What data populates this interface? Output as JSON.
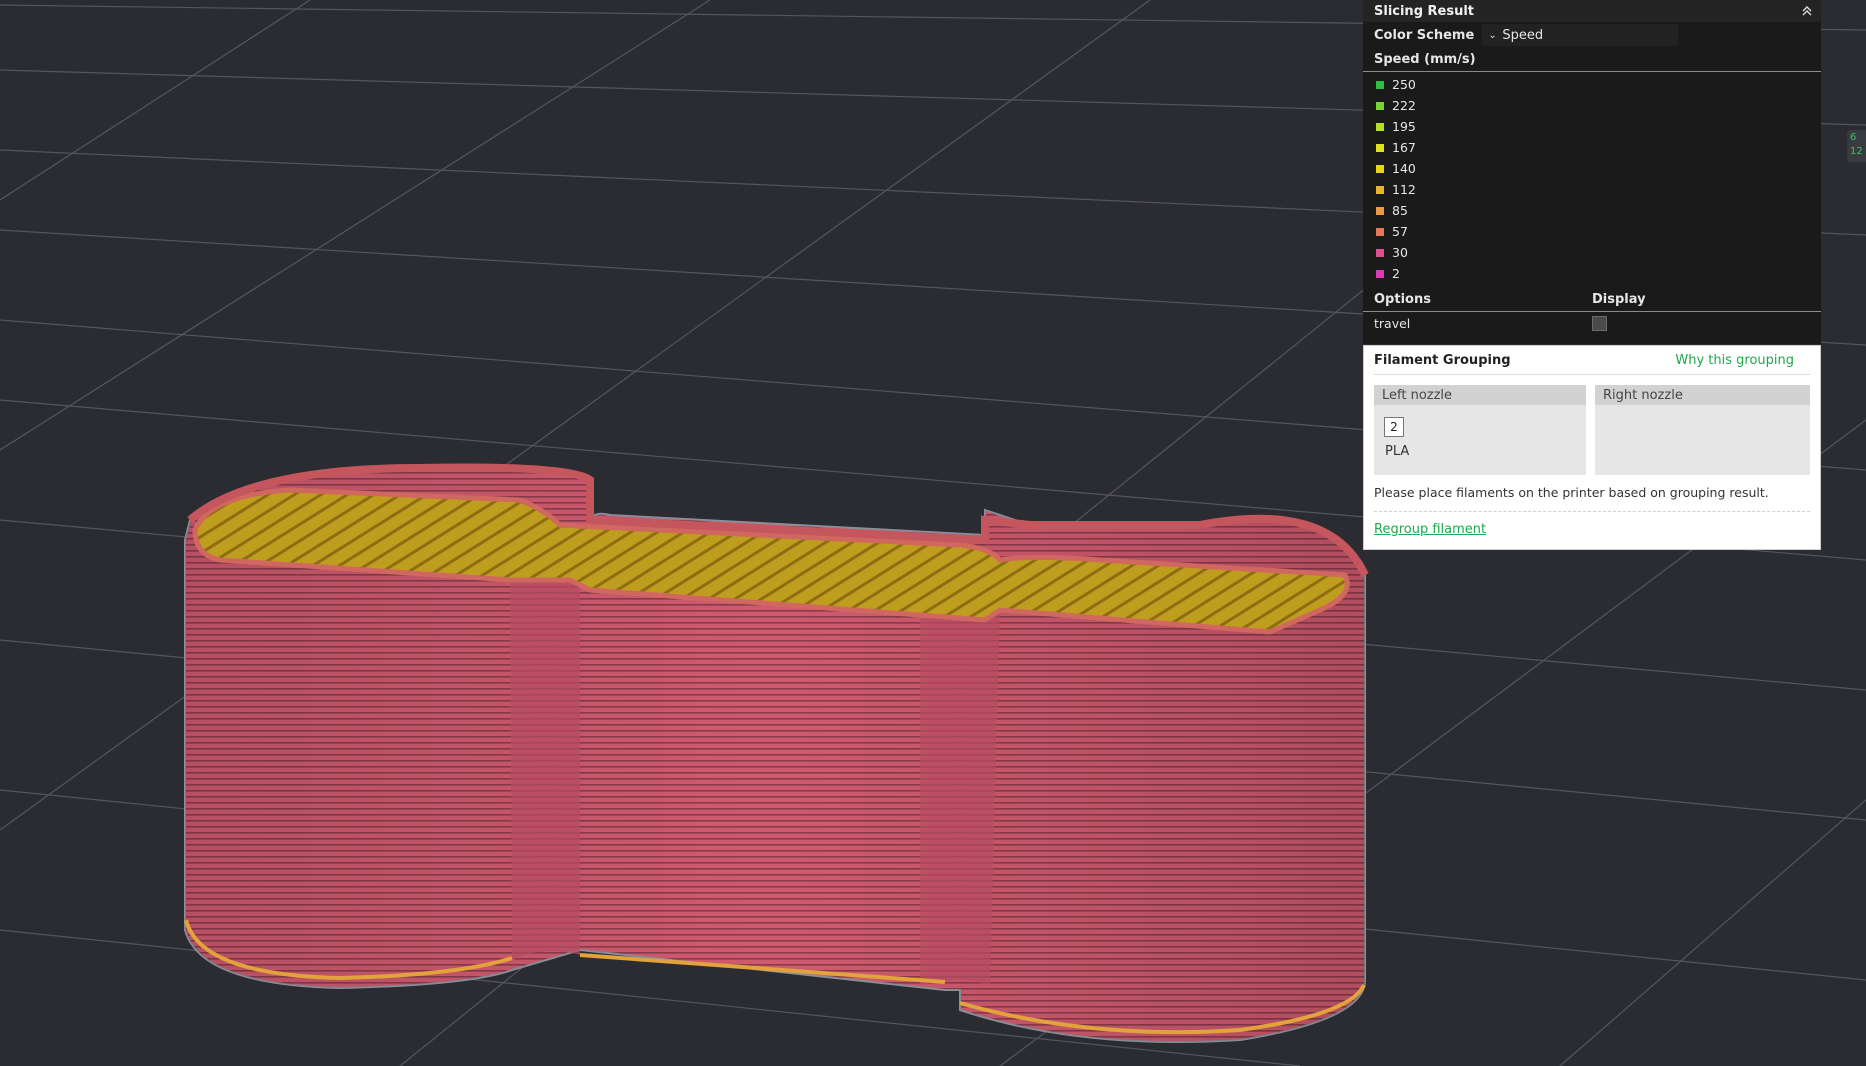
{
  "slicing_panel": {
    "title": "Slicing Result",
    "color_scheme_label": "Color Scheme",
    "color_scheme_value": "Speed",
    "legend_title": "Speed (mm/s)",
    "legend": [
      {
        "label": "250",
        "color": "#2fbf3e"
      },
      {
        "label": "222",
        "color": "#7cd431"
      },
      {
        "label": "195",
        "color": "#b7e021"
      },
      {
        "label": "167",
        "color": "#dfe21c"
      },
      {
        "label": "140",
        "color": "#e9d41c"
      },
      {
        "label": "112",
        "color": "#e7b52d"
      },
      {
        "label": "85",
        "color": "#e99a45"
      },
      {
        "label": "57",
        "color": "#e6795a"
      },
      {
        "label": "30",
        "color": "#e04e8f"
      },
      {
        "label": "2",
        "color": "#d93bb7"
      }
    ],
    "options_header": "Options",
    "display_header": "Display",
    "options": [
      {
        "label": "travel",
        "checked": false
      }
    ]
  },
  "filament_grouping": {
    "title": "Filament Grouping",
    "why_link": "Why this grouping",
    "left_nozzle": {
      "label": "Left nozzle",
      "filaments": [
        {
          "number": "2",
          "type": "PLA"
        }
      ]
    },
    "right_nozzle": {
      "label": "Right nozzle"
    },
    "note": "Please place filaments on the printer based on grouping result.",
    "regroup_link": "Regroup filament"
  },
  "edge_widget": {
    "line1": "6",
    "line2": "12"
  },
  "colors": {
    "background": "#2b2c31",
    "accent_green": "#1ea84a",
    "model_wall": "#c9546a",
    "model_top": "#b99a22"
  }
}
